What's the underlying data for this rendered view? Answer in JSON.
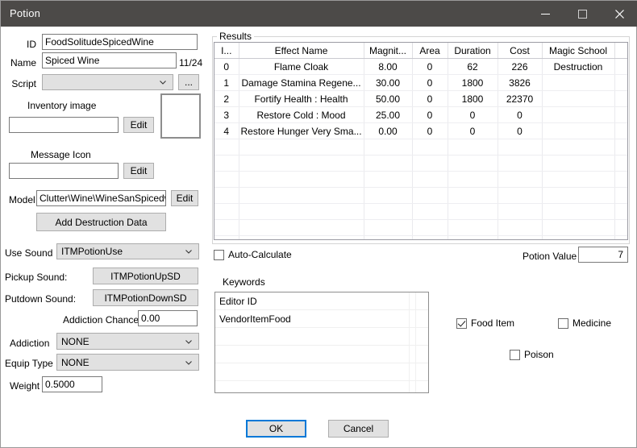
{
  "window": {
    "title": "Potion",
    "buttons": {
      "minimize": "minimize-icon",
      "maximize": "maximize-icon",
      "close": "close-icon"
    }
  },
  "form": {
    "id_label": "ID",
    "id_value": "FoodSolitudeSpicedWine",
    "name_label": "Name",
    "name_value": "Spiced Wine",
    "name_counter": "11/24",
    "script_label": "Script",
    "script_value": "",
    "script_browse_label": "...",
    "inventory_image_label": "Inventory image",
    "inventory_image_value": "",
    "inventory_image_edit_label": "Edit",
    "message_icon_label": "Message Icon",
    "message_icon_value": "",
    "message_icon_edit_label": "Edit",
    "model_label": "Model",
    "model_value": "Clutter\\Wine\\WineSanSpicedwine.nif",
    "model_edit_label": "Edit",
    "add_destruction_data_label": "Add Destruction Data",
    "use_sound_label": "Use Sound",
    "use_sound_value": "ITMPotionUse",
    "pickup_sound_label": "Pickup Sound:",
    "pickup_sound_value": "ITMPotionUpSD",
    "putdown_sound_label": "Putdown Sound:",
    "putdown_sound_value": "ITMPotionDownSD",
    "addiction_chance_label": "Addiction Chance",
    "addiction_chance_value": "0.00",
    "addiction_label": "Addiction",
    "addiction_value": "NONE",
    "equip_type_label": "Equip Type",
    "equip_type_value": "NONE",
    "weight_label": "Weight",
    "weight_value": "0.5000"
  },
  "results": {
    "group_label": "Results",
    "columns": [
      "I...",
      "Effect Name",
      "Magnit...",
      "Area",
      "Duration",
      "Cost",
      "Magic School",
      ""
    ],
    "rows": [
      {
        "index": "0",
        "effect": "Flame Cloak",
        "magnitude": "8.00",
        "area": "0",
        "duration": "62",
        "cost": "226",
        "school": "Destruction",
        "extra": ""
      },
      {
        "index": "1",
        "effect": "Damage Stamina Regene...",
        "magnitude": "30.00",
        "area": "0",
        "duration": "1800",
        "cost": "3826",
        "school": "",
        "extra": ""
      },
      {
        "index": "2",
        "effect": "Fortify Health : Health",
        "magnitude": "50.00",
        "area": "0",
        "duration": "1800",
        "cost": "22370",
        "school": "",
        "extra": ""
      },
      {
        "index": "3",
        "effect": "Restore Cold : Mood",
        "magnitude": "25.00",
        "area": "0",
        "duration": "0",
        "cost": "0",
        "school": "",
        "extra": ""
      },
      {
        "index": "4",
        "effect": "Restore Hunger Very Sma...",
        "magnitude": "0.00",
        "area": "0",
        "duration": "0",
        "cost": "0",
        "school": "",
        "extra": ""
      }
    ],
    "empty_row_count": 7
  },
  "calc": {
    "auto_calculate_label": "Auto-Calculate",
    "auto_calculate_checked": false,
    "potion_value_label": "Potion Value",
    "potion_value": "7"
  },
  "keywords": {
    "group_label": "Keywords",
    "column_header": "Editor ID",
    "items": [
      "VendorItemFood"
    ],
    "empty_row_count": 6
  },
  "flags": {
    "food_item_label": "Food Item",
    "food_item_checked": true,
    "medicine_label": "Medicine",
    "medicine_checked": false,
    "poison_label": "Poison",
    "poison_checked": false
  },
  "footer": {
    "ok_label": "OK",
    "cancel_label": "Cancel"
  }
}
